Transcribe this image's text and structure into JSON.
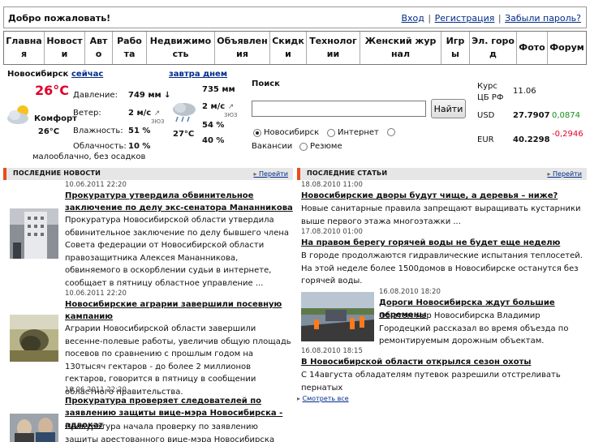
{
  "header": {
    "welcome": "Добро пожаловать!",
    "login": "Вход",
    "register": "Регистрация",
    "forgot": "Забыли пароль?"
  },
  "nav": [
    {
      "label": "Главная"
    },
    {
      "label": "Новости"
    },
    {
      "label": "Авто"
    },
    {
      "label": "Работа"
    },
    {
      "label": "Недвижимость"
    },
    {
      "label": "Объявления"
    },
    {
      "label": "Скидки"
    },
    {
      "label": "Технологии"
    },
    {
      "label": "Женский журнал"
    },
    {
      "label": "Игры"
    },
    {
      "label": "Эл. город"
    },
    {
      "label": "Фото"
    },
    {
      "label": "Форум"
    }
  ],
  "weather": {
    "city": "Новосибирск",
    "now_link": "сейчас",
    "tomorrow_link": "завтра днем",
    "temp_now": "26°C",
    "comfort_label": "Комфорт",
    "comfort_value": "26°C",
    "pressure_label": "Давление:",
    "pressure_now": "749 мм ↓",
    "wind_label": "Ветер:",
    "wind_now": "2 м/с",
    "wind_now_dir": "ЗЮЗ",
    "humidity_label": "Влажность:",
    "humidity_now": "51 %",
    "cloud_label": "Облачность:",
    "cloud_now": "10 %",
    "description": "малооблачно, без осадков",
    "tomorrow_pressure": "735 мм",
    "tomorrow_wind": "2 м/с",
    "tomorrow_wind_dir": "ЗЮЗ",
    "tomorrow_humidity": "54 %",
    "tomorrow_cloud": "40 %",
    "tomorrow_temp": "27°C"
  },
  "search": {
    "title": "Поиск",
    "button": "Найти",
    "options": [
      "Новосибирск",
      "Интернет",
      "",
      "Вакансии",
      "Резюме"
    ]
  },
  "currency": {
    "title": "Курс ЦБ РФ",
    "date": "11.06",
    "usd": {
      "code": "USD",
      "rate": "27.7907",
      "change": "0,0874"
    },
    "eur": {
      "code": "EUR",
      "rate": "40.2298",
      "change": "-0,2946"
    }
  },
  "news": {
    "title": "ПОСЛЕДНИЕ НОВОСТИ",
    "more": "Перейти",
    "items": [
      {
        "date": "10.06.2011 22:20",
        "headline": "Прокуратура утвердила обвинительное заключение по делу экс-сенатора Мананникова",
        "body": "Прокуратура Новосибирской области утвердила обвинительное заключение по делу бывшего члена Совета федерации от Новосибирской области правозащитника Алексея Мананникова, обвиняемого в оскорблении судьи в интернете, сообщает в пятницу областное управление ..."
      },
      {
        "date": "10.06.2011 22:20",
        "headline": "Новосибирские аграрии завершили посевную кампанию",
        "body": "Аграрии Новосибирской области завершили весенне-полевые работы, увеличив общую площадь посевов по сравнению с прошлым годом на 130тысяч гектаров - до более 2 миллионов гектаров, говорится в пятницу в сообщении областного правительства."
      },
      {
        "date": "10.06.2011 22:20",
        "headline": "Прокуратура проверяет следователей по заявлению защиты вице-мэра Новосибирска - адвокат",
        "body": "Прокуратура начала проверку по заявлению защиты арестованного вице-мэра Новосибирска Александра"
      }
    ]
  },
  "articles": {
    "title": "ПОСЛЕДНИЕ СТАТЬИ",
    "more": "Перейти",
    "see_all": "Смотреть все",
    "items": [
      {
        "date": "18.08.2010 11:00",
        "headline": "Новосибирские дворы будут чище, а деревья – ниже?",
        "body": "Новые санитарные правила запрещают выращивать кустарники выше первого этажа многоэтажки ..."
      },
      {
        "date": "17.08.2010 01:00",
        "headline": "На правом берегу горячей воды не будет еще неделю",
        "body": "В городе продолжаются гидравлические испытания теплосетей. На этой неделе более   1500домов в Новосибирске останутся без горячей воды."
      },
      {
        "date": "16.08.2010 18:20",
        "headline": "Дороги Новосибирска ждут большие перемены",
        "body": "Об этом мэр Новосибирска Владимир Городецкий рассказал во время объезда по ремонтируемым дорожным объектам."
      },
      {
        "date": "16.08.2010 18:15",
        "headline": "В Новосибирской области открылся сезон охоты",
        "body": "С    14августа обладателям путевок разрешили отстреливать пернатых"
      }
    ]
  },
  "colors": {
    "accent": "#e84e1b",
    "link": "#002b8a",
    "temp": "#e0002a",
    "up": "#16901b",
    "down": "#e0002a"
  }
}
